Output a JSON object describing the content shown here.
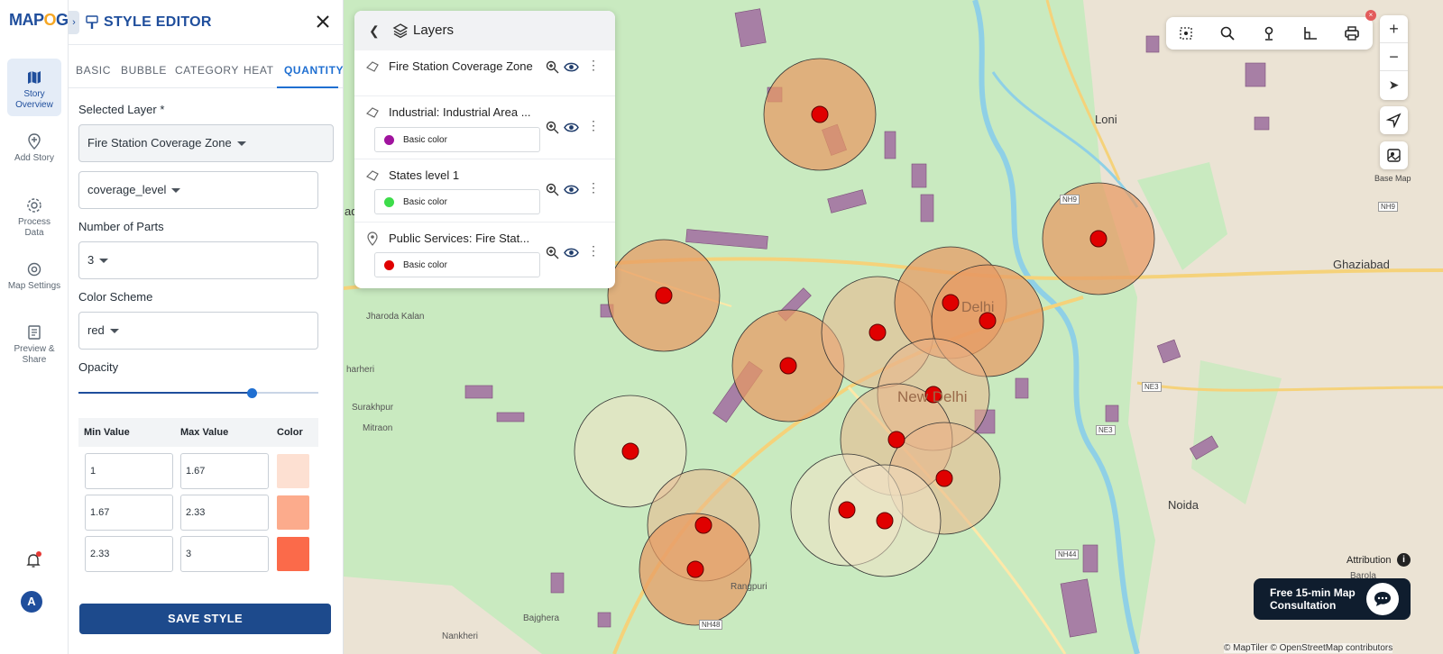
{
  "brand": {
    "logo_text_a": "MAP",
    "logo_text_b": "O",
    "logo_text_c": "G"
  },
  "rail": {
    "items": [
      {
        "label": "Story Overview",
        "icon": "map-icon"
      },
      {
        "label": "Add Story",
        "icon": "location-add-icon"
      },
      {
        "label": "Process Data",
        "icon": "gear-process-icon"
      },
      {
        "label": "Map Settings",
        "icon": "settings-icon"
      },
      {
        "label": "Preview & Share",
        "icon": "preview-icon"
      }
    ],
    "avatar": "A"
  },
  "editor": {
    "title": "STYLE EDITOR",
    "tabs": [
      "BASIC",
      "BUBBLE",
      "CATEGORY",
      "HEAT",
      "QUANTITY"
    ],
    "active_tab": "QUANTITY",
    "selected_layer_label": "Selected Layer *",
    "selected_layer_value": "Fire Station Coverage Zone",
    "field_value": "coverage_level",
    "parts_label": "Number of Parts",
    "parts_value": "3",
    "scheme_label": "Color Scheme",
    "scheme_value": "red",
    "opacity_label": "Opacity",
    "opacity_level": 0.72,
    "table": {
      "headers": [
        "Min Value",
        "Max Value",
        "Color"
      ],
      "rows": [
        {
          "min": "1",
          "max": "1.67",
          "color": "#fde0d2"
        },
        {
          "min": "1.67",
          "max": "2.33",
          "color": "#fcab8c"
        },
        {
          "min": "2.33",
          "max": "3",
          "color": "#fb6a4a"
        }
      ]
    },
    "save_label": "SAVE STYLE"
  },
  "layers": {
    "title": "Layers",
    "items": [
      {
        "name": "Fire Station Coverage Zone"
      },
      {
        "name": "Industrial: Industrial Area ...",
        "swatch_label": "Basic color",
        "swatch_color": "#a0139e"
      },
      {
        "name": "States level 1",
        "swatch_label": "Basic color",
        "swatch_color": "#3ddc4a"
      },
      {
        "name": "Public Services: Fire Stat...",
        "swatch_label": "Basic color",
        "swatch_color": "#e00000"
      }
    ]
  },
  "map": {
    "places": {
      "loni": "Loni",
      "ghaziabad": "Ghaziabad",
      "new_delhi": "New Delhi",
      "noida": "Noida",
      "jharoda": "Jharoda Kalan",
      "surakhpur": "Surakhpur",
      "mitraon": "Mitraon",
      "bajghera": "Bajghera",
      "rangpuri": "Rangpuri",
      "harheri": "harheri",
      "barola": "Barola",
      "nankheri": "Nankheri",
      "delhi": "Delhi",
      "ad": "ad"
    },
    "roads": {
      "nh9": "NH9",
      "nh9b": "NH9",
      "ne3": "NE3",
      "ne3b": "NE3",
      "nh44": "NH44",
      "nh48": "NH48"
    },
    "base_map_label": "Base Map",
    "attribution": "Attribution",
    "consultation": "Free 15-min Map Consultation",
    "consult_line1": "Free 15-min Map",
    "consult_line2": "Consultation",
    "credits": "© MapTiler © OpenStreetMap contributors"
  }
}
